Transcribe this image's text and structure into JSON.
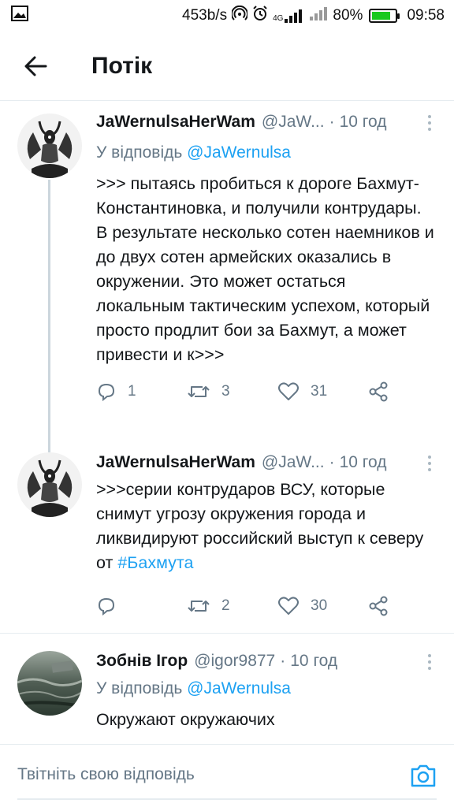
{
  "status_bar": {
    "left_icon": "image-notification-icon",
    "net_speed": "453b/s",
    "network_label": "4G",
    "battery": "80%",
    "battery_level": 0.8,
    "time": "09:58"
  },
  "header": {
    "back_icon": "arrow-left-icon",
    "title": "Потік"
  },
  "tweets": [
    {
      "name": "JaWernulsaHerWam",
      "handle": "@JaW...",
      "time": "10 год",
      "reply_prefix": "У відповідь",
      "reply_to": "@JaWernulsa",
      "text": ">>> пытаясь пробиться к дороге Бахмут-Константиновка, и получили контрудары. В результате несколько сотен наемников и до двух сотен армейских оказались в окружении. Это может остаться локальным тактическим успехом, который просто продлит бои за Бахмут, а может привести и к>>>",
      "replies": "1",
      "retweets": "3",
      "likes": "31"
    },
    {
      "name": "JaWernulsaHerWam",
      "handle": "@JaW...",
      "time": "10 год",
      "text_before": ">>>серии контрударов ВСУ, которые снимут угрозу окружения города и ликвидируют российский выступ к северу от ",
      "hashtag": "#Бахмута",
      "replies": "",
      "retweets": "2",
      "likes": "30"
    },
    {
      "name": "Зобнів Ігор",
      "handle": "@igor9877",
      "time": "10 год",
      "reply_prefix": "У відповідь",
      "reply_to": "@JaWernulsa",
      "text": "Окружают окружаючих"
    }
  ],
  "composer": {
    "placeholder": "Твітніть свою відповідь",
    "camera_icon": "camera-icon"
  },
  "colors": {
    "accent": "#1da1f2",
    "secondary_text": "#657786",
    "primary_text": "#14171a",
    "thread_line": "#ccd6dd",
    "battery_fill": "#19c81e"
  }
}
